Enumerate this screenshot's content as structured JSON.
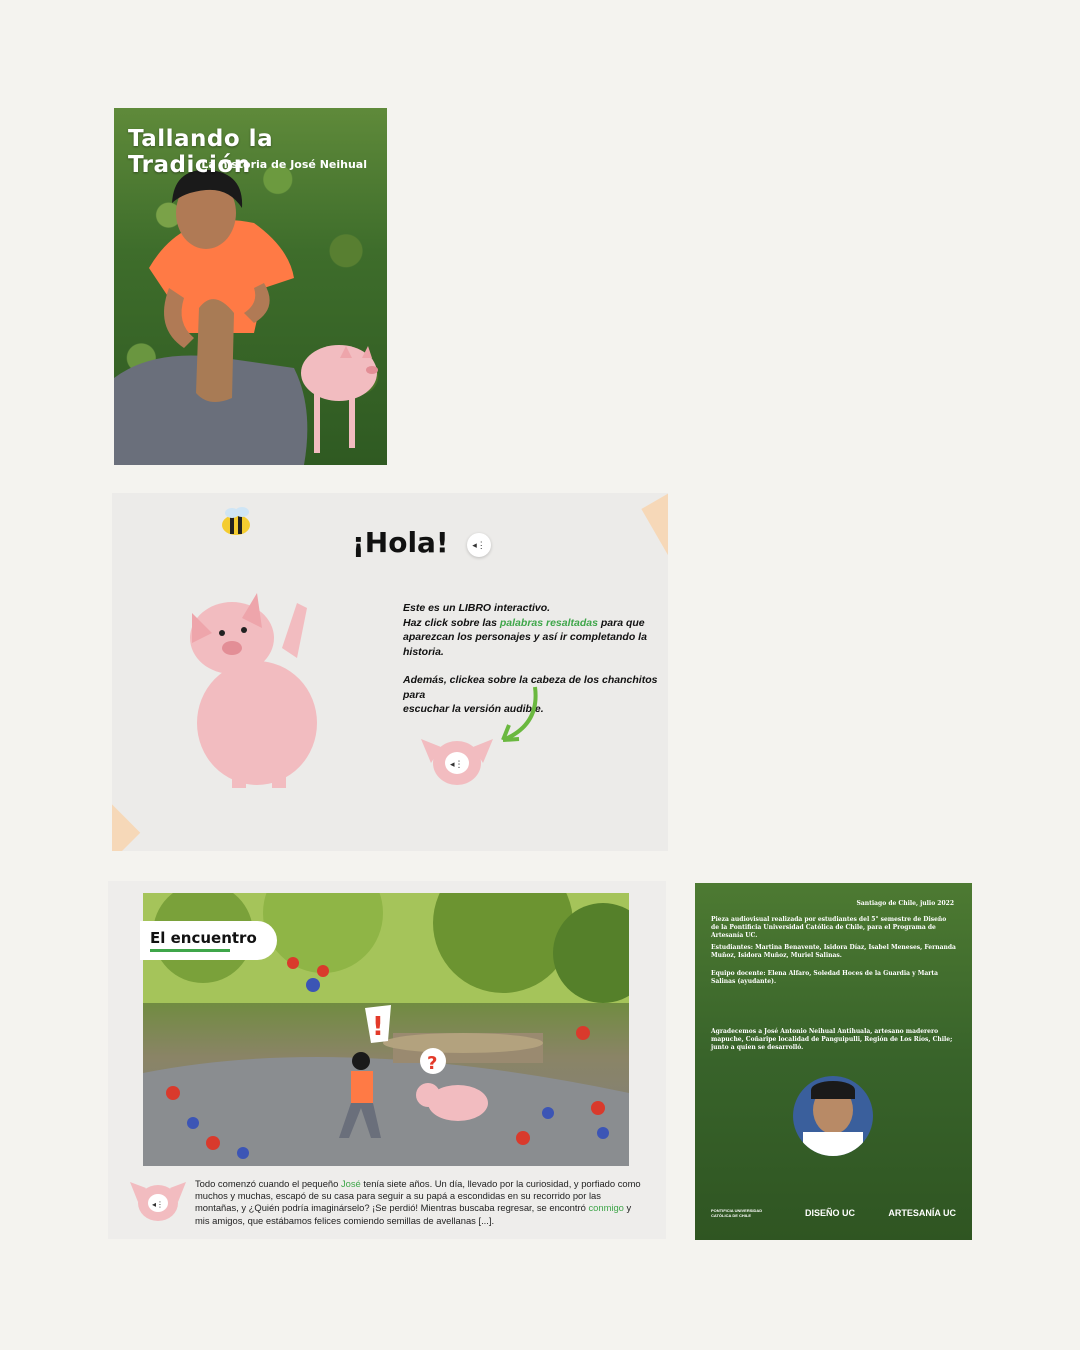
{
  "cover": {
    "title": "Tallando la Tradición",
    "subtitle": "La historia de José Neihual"
  },
  "intro_page": {
    "heading": "¡Hola!",
    "sound_icon": "speaker-icon",
    "line1": "Este es un LIBRO interactivo.",
    "line2_pre": "Haz click sobre las ",
    "line2_highlight": "palabras resaltadas",
    "line2_post": " para que",
    "line3": "aparezcan los personajes y así ir completando la historia.",
    "line4": "Además, clickea sobre la cabeza de los chanchitos para",
    "line5": "escuchar la versión audible."
  },
  "encounter_page": {
    "label": "El encuentro",
    "story_pre": "Todo comenzó cuando el pequeño ",
    "story_name": "José",
    "story_mid": " tenía siete años. Un día, llevado por la curiosidad, y porfiado como muchos y muchas, escapó de su casa para seguir a su papá a escondidas en su recorrido por las montañas, y ¿Quién podría imaginárselo? ¡Se perdió! Mientras buscaba regresar, se encontró ",
    "story_link": "conmigo",
    "story_post": " y mis amigos, que estábamos felices comiendo semillas de avellanas [...]."
  },
  "credits_page": {
    "date": "Santiago de Chile, julio 2022",
    "piece": "Pieza audiovisual realizada por estudiantes del 5° semestre de Diseño de la Pontificia Universidad Católica de Chile, para el Programa de Artesanía UC.",
    "students": "Estudiantes: Martina Benavente, Isidora Díaz, Isabel Meneses, Fernanda Muñoz, Isidora Muñoz, Muriel Salinas.",
    "teachers": "Equipo docente: Elena Alfaro, Soledad Hoces de la Guardia y Marta Salinas (ayudante).",
    "thanks": "Agradecemos a José Antonio Neihual Antihuala, artesano maderero mapuche, Coñaripe localidad de Panguipulli, Región de Los Ríos, Chile; junto a quien se desarrolló.",
    "logo_uc": "PONTIFICIA UNIVERSIDAD CATÓLICA DE CHILE",
    "logo_diseno": "DISEÑO UC",
    "logo_artesania": "ARTESANÍA UC"
  },
  "colors": {
    "highlight_green": "#3fa64a",
    "pig_pink": "#f2bcc0",
    "tape": "#f6d8b8",
    "shirt_orange": "#ff7a45"
  }
}
